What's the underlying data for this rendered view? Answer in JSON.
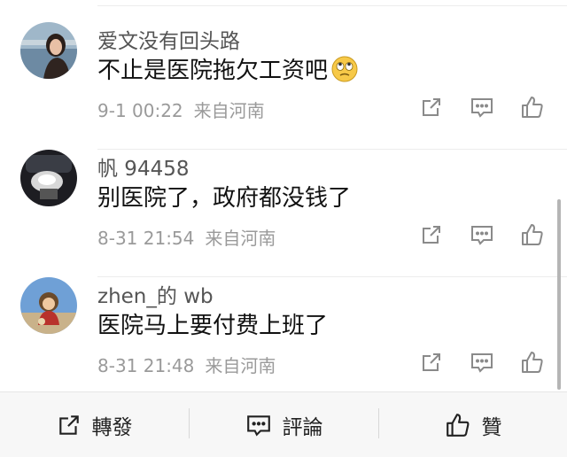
{
  "comments": [
    {
      "name": "爱文没有回头路",
      "text": "不止是医院拖欠工资吧",
      "emoji": "rolling-eyes-emoji",
      "time": "9-1 00:22",
      "source": "来自河南"
    },
    {
      "name": "帆 94458",
      "text": "别医院了，政府都没钱了",
      "time": "8-31 21:54",
      "source": "来自河南"
    },
    {
      "name": "zhen_的 wb",
      "text": "医院马上要付费上班了",
      "time": "8-31 21:48",
      "source": "来自河南"
    }
  ],
  "toolbar": {
    "repost_label": "轉發",
    "comment_label": "評論",
    "like_label": "贊"
  },
  "icons": {
    "share": "share-icon",
    "comment": "comment-icon",
    "like": "thumbs-up-icon"
  },
  "colors": {
    "icon": "#8a8a8a",
    "toolbar_bg": "#f7f7f7",
    "meta_text": "#9a9a9a"
  }
}
